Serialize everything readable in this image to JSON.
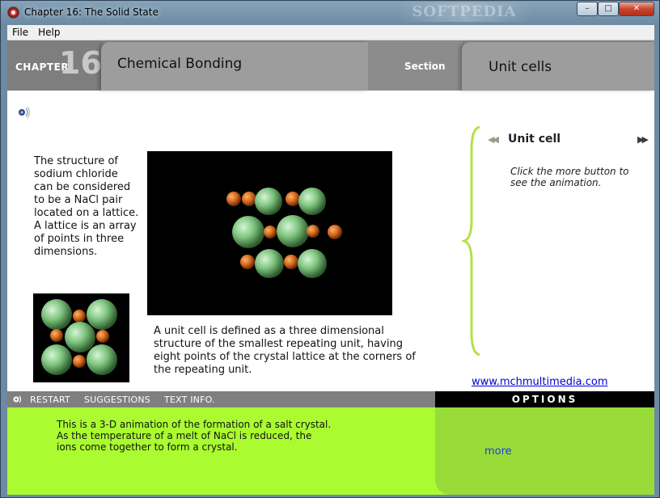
{
  "window": {
    "title": "Chapter 16: The Solid State",
    "watermark": "SOFTPEDIA",
    "buttons": {
      "minimize": "–",
      "maximize": "□",
      "close": "✕"
    }
  },
  "menu": {
    "file": "File",
    "help": "Help"
  },
  "header": {
    "chapter_label": "CHAPTER",
    "chapter_number": "16",
    "topic": "Chemical Bonding",
    "section_label": "Section",
    "unit": "Unit cells"
  },
  "content": {
    "description": "The structure of sodium chloride can be considered to be a NaCl pair located on a lattice.  A lattice is an array of points in three dimensions.",
    "caption": "A unit cell is defined as a three dimensional structure of the smallest repeating unit, having eight points of the crystal lattice at the corners of the repeating unit."
  },
  "side_panel": {
    "title": "Unit cell",
    "prev_icon": "rewind-icon",
    "next_icon": "fast-forward-icon",
    "note": "Click the more button to see the animation.",
    "link": "www.mchmultimedia.com"
  },
  "controls": {
    "restart": "RESTART",
    "suggestions": "SUGGESTIONS",
    "text_info": "TEXT INFO.",
    "options": "OPTIONS"
  },
  "bottom": {
    "text": "This is a 3-D animation of the formation of a salt crystal.  As the temperature of a melt of NaCl is reduced, the ions come together to form a crystal.",
    "more": "more"
  },
  "colors": {
    "header_gray": "#8c8c8c",
    "green": "#aafc30",
    "options_green": "#99dc3a",
    "chloride": "#7fc47f",
    "sodium": "#d2691e"
  }
}
